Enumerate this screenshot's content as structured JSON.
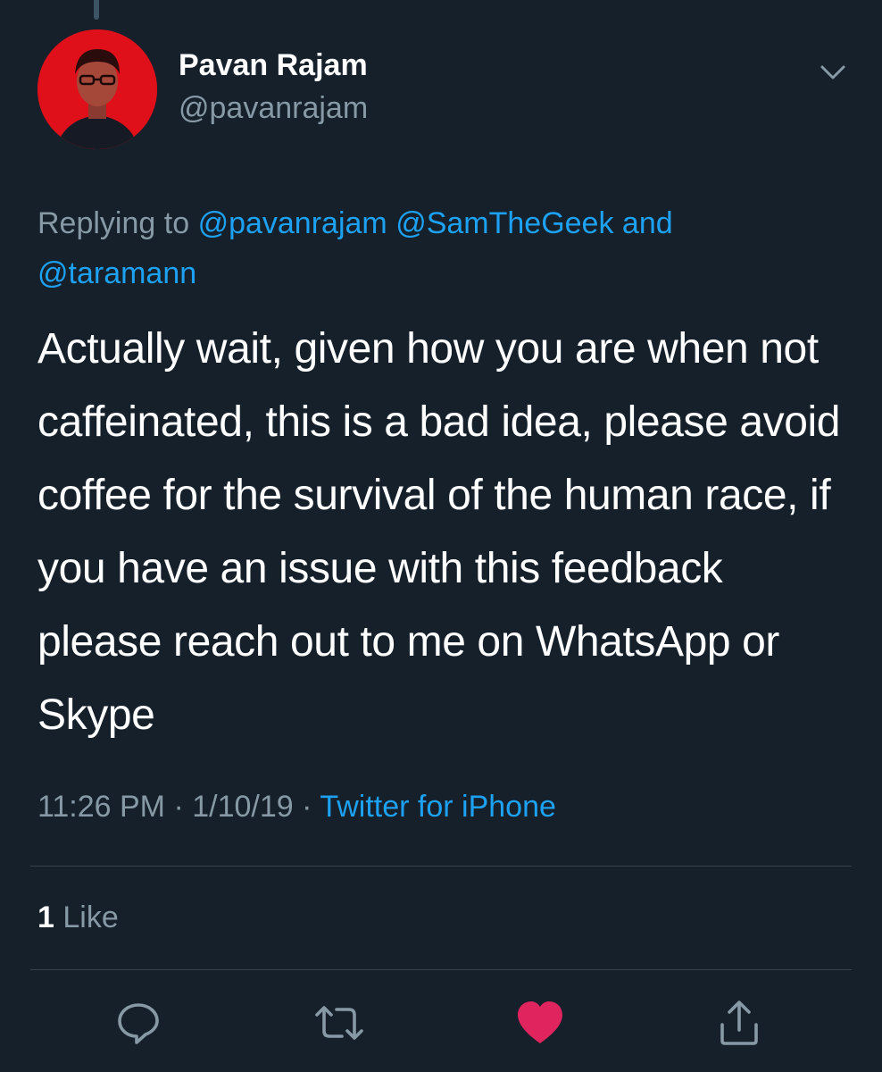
{
  "author": {
    "display_name": "Pavan Rajam",
    "handle": "@pavanrajam"
  },
  "reply": {
    "prefix": "Replying to",
    "mention_1": "@pavanrajam",
    "mention_2": "@SamTheGeek",
    "conjunction": "and",
    "mention_3": "@taramann"
  },
  "tweet": {
    "text": "Actually wait, given how you are when not caffeinated, this is a bad idea, please avoid coffee for the survival of the human race, if you have an issue with this feedback please reach out to me on WhatsApp or Skype"
  },
  "meta": {
    "time": "11:26 PM",
    "separator_1": "·",
    "date": "1/10/19",
    "separator_2": "·",
    "source": "Twitter for iPhone"
  },
  "stats": {
    "like_count": "1",
    "like_label": "Like"
  },
  "actions": {
    "reply_icon": "reply-icon",
    "retweet_icon": "retweet-icon",
    "like_icon": "heart-icon",
    "share_icon": "share-icon"
  },
  "colors": {
    "background": "#15202b",
    "accent": "#1da1f2",
    "secondary_text": "#8899a6",
    "liked_heart": "#e0245e",
    "avatar_bg": "#e0101a"
  }
}
